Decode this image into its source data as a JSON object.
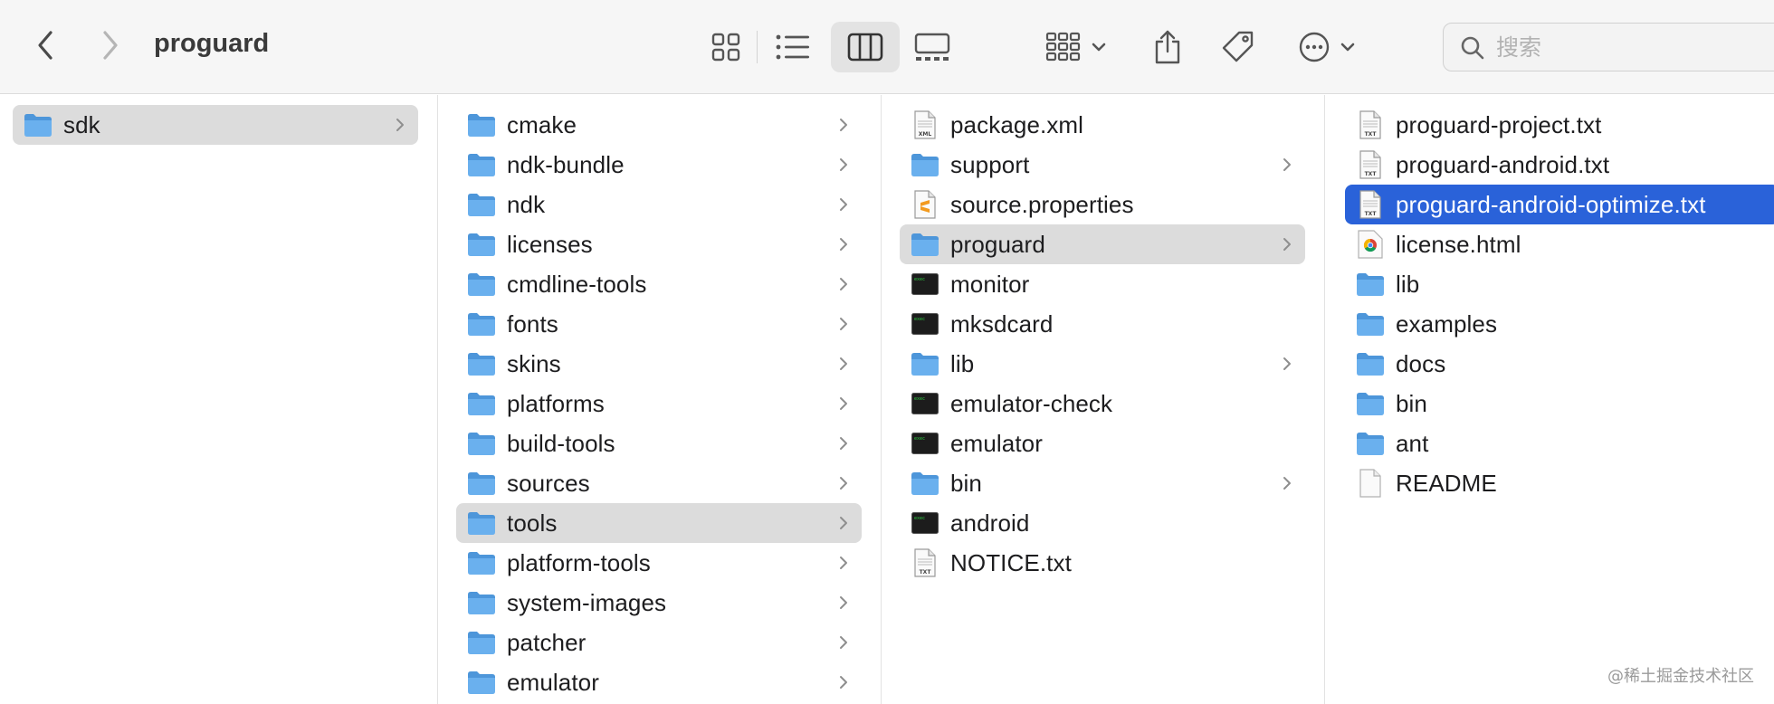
{
  "window": {
    "title": "proguard"
  },
  "toolbar": {
    "back_icon": "chevron-left-icon",
    "forward_icon": "chevron-right-icon",
    "view_modes": [
      "icon-view-icon",
      "list-view-icon",
      "column-view-icon",
      "gallery-view-icon"
    ],
    "active_view": "column-view-icon",
    "group_icon": "group-by-icon",
    "share_icon": "share-icon",
    "tag_icon": "tag-icon",
    "more_icon": "ellipsis-circle-icon"
  },
  "search": {
    "placeholder": "搜索",
    "value": ""
  },
  "colors": {
    "folder_fill": "#6ab0ee",
    "folder_tab": "#4d96da",
    "selection_blue": "#2a62d9",
    "selection_grey": "#dcdcdc",
    "toolbar_bg": "#f6f6f6"
  },
  "columns": [
    {
      "items": [
        {
          "label": "sdk",
          "icon": "folder-icon",
          "has_children": true,
          "selected": "grey"
        }
      ]
    },
    {
      "items": [
        {
          "label": "cmake",
          "icon": "folder-icon",
          "has_children": true
        },
        {
          "label": "ndk-bundle",
          "icon": "folder-icon",
          "has_children": true
        },
        {
          "label": "ndk",
          "icon": "folder-icon",
          "has_children": true
        },
        {
          "label": "licenses",
          "icon": "folder-icon",
          "has_children": true
        },
        {
          "label": "cmdline-tools",
          "icon": "folder-icon",
          "has_children": true
        },
        {
          "label": "fonts",
          "icon": "folder-icon",
          "has_children": true
        },
        {
          "label": "skins",
          "icon": "folder-icon",
          "has_children": true
        },
        {
          "label": "platforms",
          "icon": "folder-icon",
          "has_children": true
        },
        {
          "label": "build-tools",
          "icon": "folder-icon",
          "has_children": true
        },
        {
          "label": "sources",
          "icon": "folder-icon",
          "has_children": true
        },
        {
          "label": "tools",
          "icon": "folder-icon",
          "has_children": true,
          "selected": "grey"
        },
        {
          "label": "platform-tools",
          "icon": "folder-icon",
          "has_children": true
        },
        {
          "label": "system-images",
          "icon": "folder-icon",
          "has_children": true
        },
        {
          "label": "patcher",
          "icon": "folder-icon",
          "has_children": true
        },
        {
          "label": "emulator",
          "icon": "folder-icon",
          "has_children": true
        }
      ]
    },
    {
      "items": [
        {
          "label": "package.xml",
          "icon": "xml-file-icon",
          "has_children": false
        },
        {
          "label": "support",
          "icon": "folder-icon",
          "has_children": true
        },
        {
          "label": "source.properties",
          "icon": "sublime-file-icon",
          "has_children": false
        },
        {
          "label": "proguard",
          "icon": "folder-icon",
          "has_children": true,
          "selected": "grey"
        },
        {
          "label": "monitor",
          "icon": "terminal-exec-icon",
          "has_children": false
        },
        {
          "label": "mksdcard",
          "icon": "terminal-exec-icon",
          "has_children": false
        },
        {
          "label": "lib",
          "icon": "folder-icon",
          "has_children": true
        },
        {
          "label": "emulator-check",
          "icon": "terminal-exec-icon",
          "has_children": false
        },
        {
          "label": "emulator",
          "icon": "terminal-exec-icon",
          "has_children": false
        },
        {
          "label": "bin",
          "icon": "folder-icon",
          "has_children": true
        },
        {
          "label": "android",
          "icon": "terminal-exec-icon",
          "has_children": false
        },
        {
          "label": "NOTICE.txt",
          "icon": "txt-file-icon",
          "has_children": false
        }
      ]
    },
    {
      "items": [
        {
          "label": "proguard-project.txt",
          "icon": "txt-file-icon",
          "has_children": false
        },
        {
          "label": "proguard-android.txt",
          "icon": "txt-file-icon",
          "has_children": false
        },
        {
          "label": "proguard-android-optimize.txt",
          "icon": "txt-file-icon",
          "has_children": false,
          "selected": "blue"
        },
        {
          "label": "license.html",
          "icon": "chrome-html-icon",
          "has_children": false
        },
        {
          "label": "lib",
          "icon": "folder-icon",
          "has_children": false
        },
        {
          "label": "examples",
          "icon": "folder-icon",
          "has_children": false
        },
        {
          "label": "docs",
          "icon": "folder-icon",
          "has_children": false
        },
        {
          "label": "bin",
          "icon": "folder-icon",
          "has_children": false
        },
        {
          "label": "ant",
          "icon": "folder-icon",
          "has_children": false
        },
        {
          "label": "README",
          "icon": "blank-file-icon",
          "has_children": false
        }
      ]
    }
  ],
  "watermark": "@稀土掘金技术社区"
}
